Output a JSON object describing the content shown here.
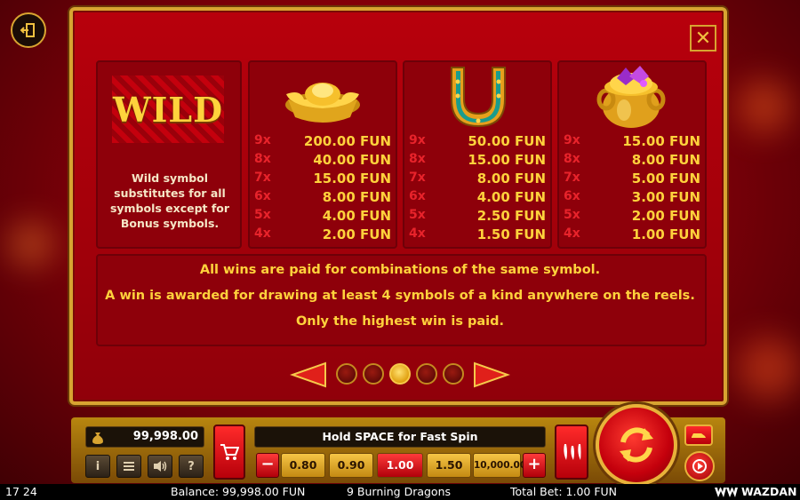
{
  "exit_icon": "exit-door-icon",
  "close_label": "✕",
  "wild": {
    "label": "WILD",
    "description_lines": [
      "Wild symbol",
      "substitutes for all",
      "symbols except for",
      "Bonus symbols."
    ]
  },
  "paytable": [
    {
      "symbol": "gold-ingot-icon",
      "rows": [
        {
          "mult": "9x",
          "value": "200.00 FUN"
        },
        {
          "mult": "8x",
          "value": "40.00 FUN"
        },
        {
          "mult": "7x",
          "value": "15.00 FUN"
        },
        {
          "mult": "6x",
          "value": "8.00 FUN"
        },
        {
          "mult": "5x",
          "value": "4.00 FUN"
        },
        {
          "mult": "4x",
          "value": "2.00 FUN"
        }
      ]
    },
    {
      "symbol": "horseshoe-icon",
      "rows": [
        {
          "mult": "9x",
          "value": "50.00 FUN"
        },
        {
          "mult": "8x",
          "value": "15.00 FUN"
        },
        {
          "mult": "7x",
          "value": "8.00 FUN"
        },
        {
          "mult": "6x",
          "value": "4.00 FUN"
        },
        {
          "mult": "5x",
          "value": "2.50 FUN"
        },
        {
          "mult": "4x",
          "value": "1.50 FUN"
        }
      ]
    },
    {
      "symbol": "pot-of-gold-icon",
      "rows": [
        {
          "mult": "9x",
          "value": "15.00 FUN"
        },
        {
          "mult": "8x",
          "value": "8.00 FUN"
        },
        {
          "mult": "7x",
          "value": "5.00 FUN"
        },
        {
          "mult": "6x",
          "value": "3.00 FUN"
        },
        {
          "mult": "5x",
          "value": "2.00 FUN"
        },
        {
          "mult": "4x",
          "value": "1.00 FUN"
        }
      ]
    }
  ],
  "rules": [
    "All wins are paid for combinations of the same symbol.",
    "A win is awarded for drawing at least 4 symbols of a kind anywhere on the reels.",
    "Only the highest win is paid."
  ],
  "pagination": {
    "pages": 5,
    "active_page": 3
  },
  "controls": {
    "balance": "99,998.00",
    "hint": "Hold SPACE for Fast Spin",
    "bet_options": [
      "0.80",
      "0.90",
      "1.00",
      "1.50",
      "10,000.00"
    ],
    "selected_bet": "1.00",
    "info_label": "i",
    "help_label": "?",
    "minus_label": "−",
    "plus_label": "+"
  },
  "status": {
    "time": "17 24",
    "balance": "Balance: 99,998.00 FUN",
    "game_title": "9 Burning Dragons",
    "total_bet": "Total Bet: 1.00 FUN",
    "brand": "WAZDAN"
  },
  "colors": {
    "gold": "#ffd23c",
    "red_multiplier": "#e8232b",
    "panel_red": "#a1000a"
  }
}
